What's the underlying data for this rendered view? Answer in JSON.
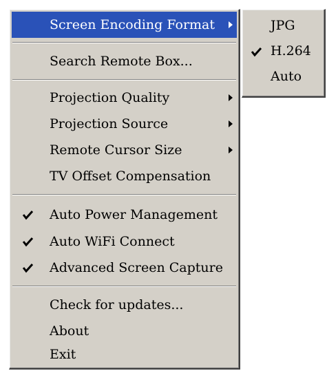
{
  "menu": {
    "items": [
      {
        "label": "Screen Encoding Format",
        "checked": false,
        "submenu": true,
        "highlighted": true
      },
      {
        "label": "Search Remote Box...",
        "checked": false,
        "submenu": false
      },
      {
        "label": "Projection Quality",
        "checked": false,
        "submenu": true
      },
      {
        "label": "Projection Source",
        "checked": false,
        "submenu": true
      },
      {
        "label": "Remote Cursor Size",
        "checked": false,
        "submenu": true
      },
      {
        "label": "TV Offset Compensation",
        "checked": false,
        "submenu": false
      },
      {
        "label": "Auto Power Management",
        "checked": true,
        "submenu": false
      },
      {
        "label": "Auto WiFi Connect",
        "checked": true,
        "submenu": false
      },
      {
        "label": "Advanced Screen Capture",
        "checked": true,
        "submenu": false
      },
      {
        "label": "Check for updates...",
        "checked": false,
        "submenu": false
      },
      {
        "label": "About",
        "checked": false,
        "submenu": false
      },
      {
        "label": "Exit",
        "checked": false,
        "submenu": false
      }
    ]
  },
  "submenu": {
    "items": [
      {
        "label": "JPG",
        "checked": false
      },
      {
        "label": "H.264",
        "checked": true
      },
      {
        "label": "Auto",
        "checked": false
      }
    ]
  },
  "colors": {
    "menu_background": "#d4d0c8",
    "highlight": "#2a52b8",
    "highlight_text": "#ffffff",
    "text": "#000000"
  },
  "icons": {
    "check": "checkmark-icon",
    "submenu_arrow": "submenu-arrow-icon"
  }
}
